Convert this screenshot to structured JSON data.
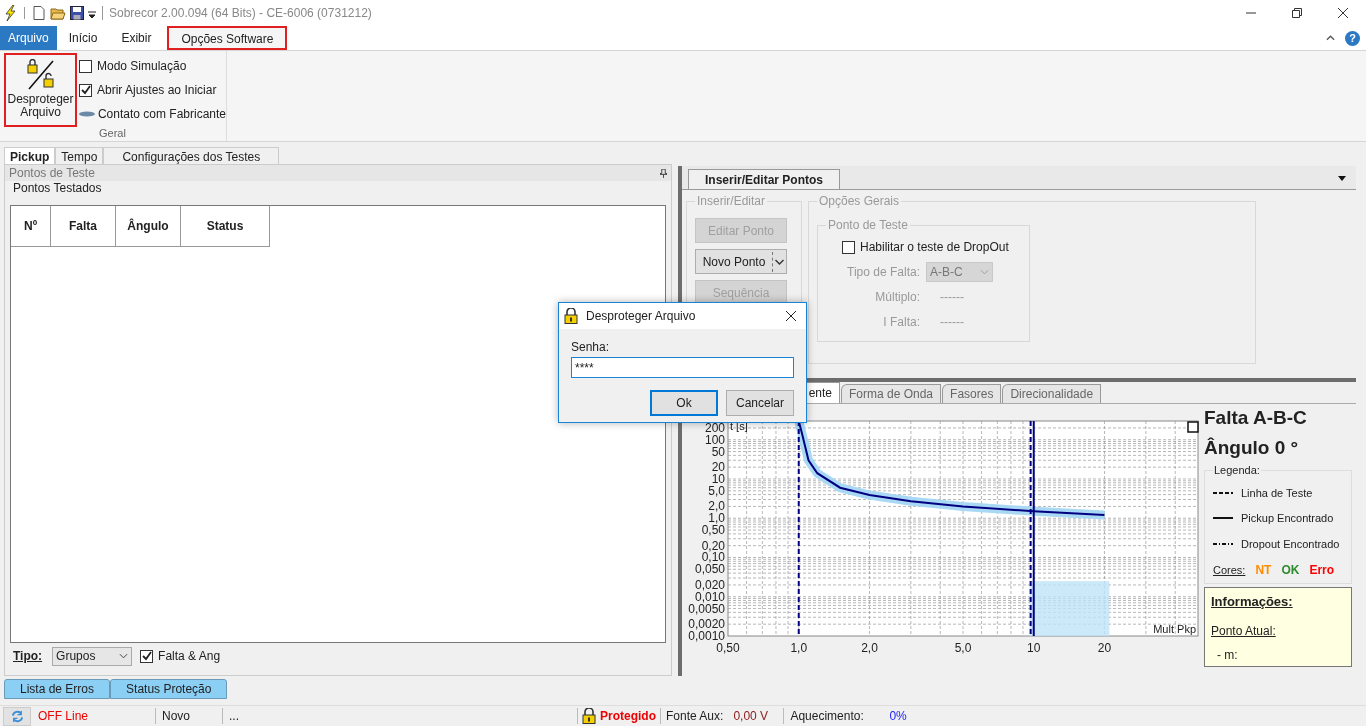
{
  "window": {
    "title": "Sobrecor 2.00.094 (64 Bits) - CE-6006 (0731212)"
  },
  "menu_tabs": [
    {
      "label": "Arquivo",
      "kind": "file",
      "selected": false,
      "highlighted": false
    },
    {
      "label": "Início",
      "kind": "tab",
      "selected": false,
      "highlighted": false
    },
    {
      "label": "Exibir",
      "kind": "tab",
      "selected": false,
      "highlighted": false
    },
    {
      "label": "Opções Software",
      "kind": "tab",
      "selected": true,
      "highlighted": true
    }
  ],
  "help": "?",
  "ribbon": {
    "big_button": {
      "label": "Desproteger Arquivo",
      "highlighted": true
    },
    "options": [
      {
        "kind": "checkbox",
        "label": "Modo Simulação",
        "checked": false
      },
      {
        "kind": "checkbox",
        "label": "Abrir Ajustes ao Iniciar",
        "checked": true
      },
      {
        "kind": "link",
        "label": "Contato com Fabricante"
      }
    ],
    "group_label": "Geral"
  },
  "left_panel": {
    "tabs": [
      {
        "label": "Pickup",
        "selected": true
      },
      {
        "label": "Tempo",
        "selected": false
      },
      {
        "label": "Configurações dos Testes",
        "selected": false
      }
    ],
    "title": "Pontos de Teste",
    "group_label": "Pontos Testados",
    "table": {
      "columns": [
        "Nº",
        "Falta",
        "Ângulo",
        "Status"
      ]
    },
    "type_label": "Tipo:",
    "type_select": {
      "value": "Grupos"
    },
    "falta_ang": {
      "label": "Falta & Ang",
      "checked": true
    },
    "bottom_tabs": [
      "Lista de Erros",
      "Status Proteção"
    ]
  },
  "edit_panel": {
    "tab": "Inserir/Editar Pontos",
    "insert_group": {
      "label": "Inserir/Editar",
      "buttons": [
        {
          "label": "Editar Ponto",
          "kind": "button",
          "disabled": true
        },
        {
          "label": "Novo Ponto",
          "kind": "split",
          "disabled": false
        },
        {
          "label": "Sequência",
          "kind": "button",
          "disabled": true
        }
      ]
    },
    "options_group": {
      "label": "Opções Gerais",
      "disabled": true,
      "test_point": {
        "label": "Ponto de Teste",
        "dropout": {
          "label": "Habilitar o teste de DropOut",
          "checked": false
        },
        "fields": [
          {
            "kind": "select",
            "label": "Tipo de Falta:",
            "value": "A-B-C"
          },
          {
            "kind": "text",
            "label": "Múltiplo:",
            "value": "------"
          },
          {
            "kind": "text",
            "label": "I Falta:",
            "value": "------"
          }
        ]
      }
    }
  },
  "graph_panel": {
    "tabs": [
      {
        "label": "ente",
        "selected": true
      },
      {
        "label": "Forma de Onda",
        "selected": false
      },
      {
        "label": "Fasores",
        "selected": false
      },
      {
        "label": "Direcionalidade",
        "selected": false
      }
    ],
    "graph": {
      "xlabel": "Mult Pkp",
      "ylabel": "t [s]",
      "x_tick_labels": [
        "0,50",
        "1,0",
        "2,0",
        "5,0",
        "10",
        "20"
      ],
      "y_tick_labels": [
        "200",
        "100",
        "50",
        "20",
        "10",
        "5,0",
        "2,0",
        "1,0",
        "0,50",
        "0,20",
        "0,10",
        "0,050",
        "0,020",
        "0,010",
        "0,0050",
        "0,0020",
        "0,0010"
      ]
    },
    "side": {
      "title": "Falta A-B-C",
      "angle": "Ângulo 0 °",
      "legend_label": "Legenda:",
      "legend": [
        {
          "label": "Linha de Teste"
        },
        {
          "label": "Pickup Encontrado"
        },
        {
          "label": "Dropout Encontrado"
        }
      ],
      "colors_label": "Cores:",
      "colors": [
        {
          "label": "NT",
          "color": "#ff8c00"
        },
        {
          "label": "OK",
          "color": "#2e8b2e"
        },
        {
          "label": "Erro",
          "color": "#ff0000"
        }
      ],
      "info": {
        "title": "Informações:",
        "current_point": "Ponto Atual:",
        "m": "- m:"
      }
    }
  },
  "dialog": {
    "title": "Desproteger Arquivo",
    "field_label": "Senha:",
    "value": "****",
    "buttons": [
      {
        "label": "Ok",
        "kind": "default"
      },
      {
        "label": "Cancelar",
        "kind": "normal"
      }
    ]
  },
  "status_bar": {
    "connection": "OFF Line",
    "file_state": "Novo",
    "message": "...",
    "protection": "Protegido",
    "aux_label": "Fonte Aux:",
    "aux_value": "0,00 V",
    "heating_label": "Aquecimento:",
    "heating_value": "0%"
  }
}
